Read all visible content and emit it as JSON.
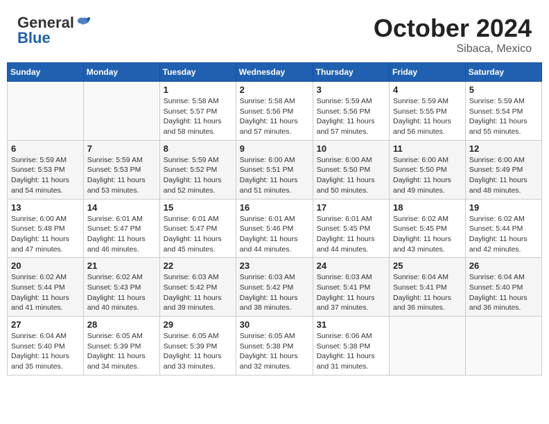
{
  "header": {
    "logo_line1": "General",
    "logo_line2": "Blue",
    "month_title": "October 2024",
    "location": "Sibaca, Mexico"
  },
  "days_of_week": [
    "Sunday",
    "Monday",
    "Tuesday",
    "Wednesday",
    "Thursday",
    "Friday",
    "Saturday"
  ],
  "weeks": [
    [
      {
        "day": "",
        "info": ""
      },
      {
        "day": "",
        "info": ""
      },
      {
        "day": "1",
        "info": "Sunrise: 5:58 AM\nSunset: 5:57 PM\nDaylight: 11 hours and 58 minutes."
      },
      {
        "day": "2",
        "info": "Sunrise: 5:58 AM\nSunset: 5:56 PM\nDaylight: 11 hours and 57 minutes."
      },
      {
        "day": "3",
        "info": "Sunrise: 5:59 AM\nSunset: 5:56 PM\nDaylight: 11 hours and 57 minutes."
      },
      {
        "day": "4",
        "info": "Sunrise: 5:59 AM\nSunset: 5:55 PM\nDaylight: 11 hours and 56 minutes."
      },
      {
        "day": "5",
        "info": "Sunrise: 5:59 AM\nSunset: 5:54 PM\nDaylight: 11 hours and 55 minutes."
      }
    ],
    [
      {
        "day": "6",
        "info": "Sunrise: 5:59 AM\nSunset: 5:53 PM\nDaylight: 11 hours and 54 minutes."
      },
      {
        "day": "7",
        "info": "Sunrise: 5:59 AM\nSunset: 5:53 PM\nDaylight: 11 hours and 53 minutes."
      },
      {
        "day": "8",
        "info": "Sunrise: 5:59 AM\nSunset: 5:52 PM\nDaylight: 11 hours and 52 minutes."
      },
      {
        "day": "9",
        "info": "Sunrise: 6:00 AM\nSunset: 5:51 PM\nDaylight: 11 hours and 51 minutes."
      },
      {
        "day": "10",
        "info": "Sunrise: 6:00 AM\nSunset: 5:50 PM\nDaylight: 11 hours and 50 minutes."
      },
      {
        "day": "11",
        "info": "Sunrise: 6:00 AM\nSunset: 5:50 PM\nDaylight: 11 hours and 49 minutes."
      },
      {
        "day": "12",
        "info": "Sunrise: 6:00 AM\nSunset: 5:49 PM\nDaylight: 11 hours and 48 minutes."
      }
    ],
    [
      {
        "day": "13",
        "info": "Sunrise: 6:00 AM\nSunset: 5:48 PM\nDaylight: 11 hours and 47 minutes."
      },
      {
        "day": "14",
        "info": "Sunrise: 6:01 AM\nSunset: 5:47 PM\nDaylight: 11 hours and 46 minutes."
      },
      {
        "day": "15",
        "info": "Sunrise: 6:01 AM\nSunset: 5:47 PM\nDaylight: 11 hours and 45 minutes."
      },
      {
        "day": "16",
        "info": "Sunrise: 6:01 AM\nSunset: 5:46 PM\nDaylight: 11 hours and 44 minutes."
      },
      {
        "day": "17",
        "info": "Sunrise: 6:01 AM\nSunset: 5:45 PM\nDaylight: 11 hours and 44 minutes."
      },
      {
        "day": "18",
        "info": "Sunrise: 6:02 AM\nSunset: 5:45 PM\nDaylight: 11 hours and 43 minutes."
      },
      {
        "day": "19",
        "info": "Sunrise: 6:02 AM\nSunset: 5:44 PM\nDaylight: 11 hours and 42 minutes."
      }
    ],
    [
      {
        "day": "20",
        "info": "Sunrise: 6:02 AM\nSunset: 5:44 PM\nDaylight: 11 hours and 41 minutes."
      },
      {
        "day": "21",
        "info": "Sunrise: 6:02 AM\nSunset: 5:43 PM\nDaylight: 11 hours and 40 minutes."
      },
      {
        "day": "22",
        "info": "Sunrise: 6:03 AM\nSunset: 5:42 PM\nDaylight: 11 hours and 39 minutes."
      },
      {
        "day": "23",
        "info": "Sunrise: 6:03 AM\nSunset: 5:42 PM\nDaylight: 11 hours and 38 minutes."
      },
      {
        "day": "24",
        "info": "Sunrise: 6:03 AM\nSunset: 5:41 PM\nDaylight: 11 hours and 37 minutes."
      },
      {
        "day": "25",
        "info": "Sunrise: 6:04 AM\nSunset: 5:41 PM\nDaylight: 11 hours and 36 minutes."
      },
      {
        "day": "26",
        "info": "Sunrise: 6:04 AM\nSunset: 5:40 PM\nDaylight: 11 hours and 36 minutes."
      }
    ],
    [
      {
        "day": "27",
        "info": "Sunrise: 6:04 AM\nSunset: 5:40 PM\nDaylight: 11 hours and 35 minutes."
      },
      {
        "day": "28",
        "info": "Sunrise: 6:05 AM\nSunset: 5:39 PM\nDaylight: 11 hours and 34 minutes."
      },
      {
        "day": "29",
        "info": "Sunrise: 6:05 AM\nSunset: 5:39 PM\nDaylight: 11 hours and 33 minutes."
      },
      {
        "day": "30",
        "info": "Sunrise: 6:05 AM\nSunset: 5:38 PM\nDaylight: 11 hours and 32 minutes."
      },
      {
        "day": "31",
        "info": "Sunrise: 6:06 AM\nSunset: 5:38 PM\nDaylight: 11 hours and 31 minutes."
      },
      {
        "day": "",
        "info": ""
      },
      {
        "day": "",
        "info": ""
      }
    ]
  ]
}
